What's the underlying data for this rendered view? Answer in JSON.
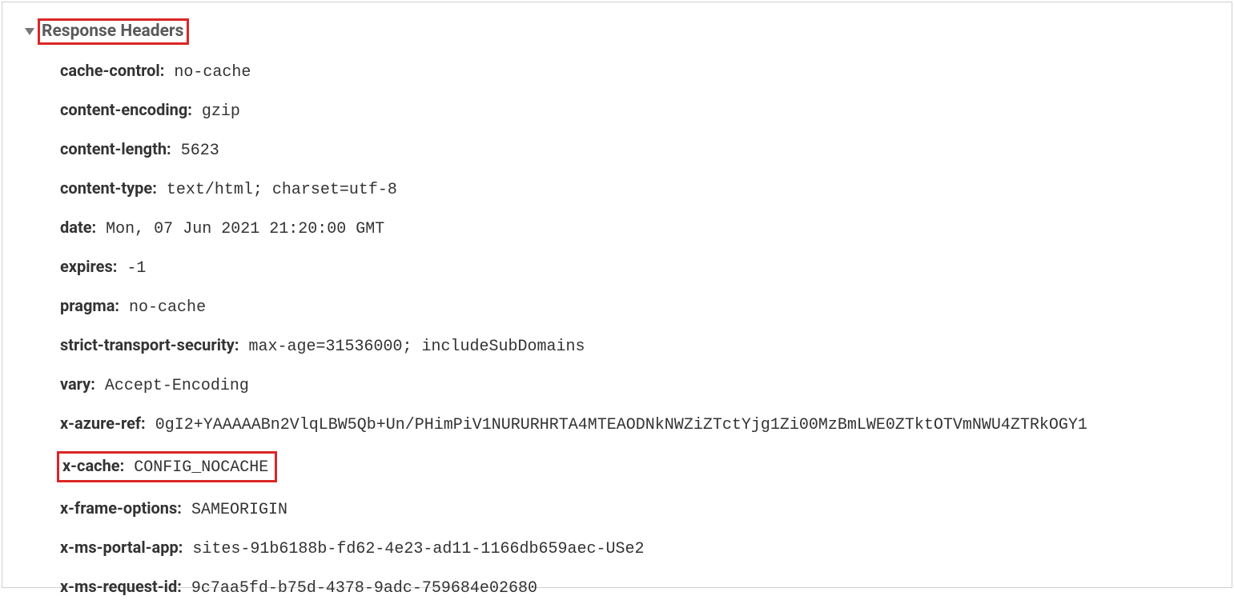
{
  "section_title": "Response Headers",
  "headers": [
    {
      "key": "cache-control:",
      "value": " no-cache",
      "highlighted": false
    },
    {
      "key": "content-encoding:",
      "value": " gzip",
      "highlighted": false
    },
    {
      "key": "content-length:",
      "value": " 5623",
      "highlighted": false
    },
    {
      "key": "content-type:",
      "value": " text/html; charset=utf-8",
      "highlighted": false
    },
    {
      "key": "date:",
      "value": " Mon, 07 Jun 2021 21:20:00 GMT",
      "highlighted": false
    },
    {
      "key": "expires:",
      "value": " -1",
      "highlighted": false
    },
    {
      "key": "pragma:",
      "value": " no-cache",
      "highlighted": false
    },
    {
      "key": "strict-transport-security:",
      "value": " max-age=31536000; includeSubDomains",
      "highlighted": false
    },
    {
      "key": "vary:",
      "value": " Accept-Encoding",
      "highlighted": false
    },
    {
      "key": "x-azure-ref:",
      "value": " 0gI2+YAAAAABn2VlqLBW5Qb+Un/PHimPiV1NURURHRTA4MTEAODNkNWZiZTctYjg1Zi00MzBmLWE0ZTktOTVmNWU4ZTRkOGY1",
      "highlighted": false
    },
    {
      "key": "x-cache:",
      "value": " CONFIG_NOCACHE",
      "highlighted": true
    },
    {
      "key": "x-frame-options:",
      "value": " SAMEORIGIN",
      "highlighted": false
    },
    {
      "key": "x-ms-portal-app:",
      "value": " sites-91b6188b-fd62-4e23-ad11-1166db659aec-USe2",
      "highlighted": false
    },
    {
      "key": "x-ms-request-id:",
      "value": " 9c7aa5fd-b75d-4378-9adc-759684e02680",
      "highlighted": false
    }
  ]
}
